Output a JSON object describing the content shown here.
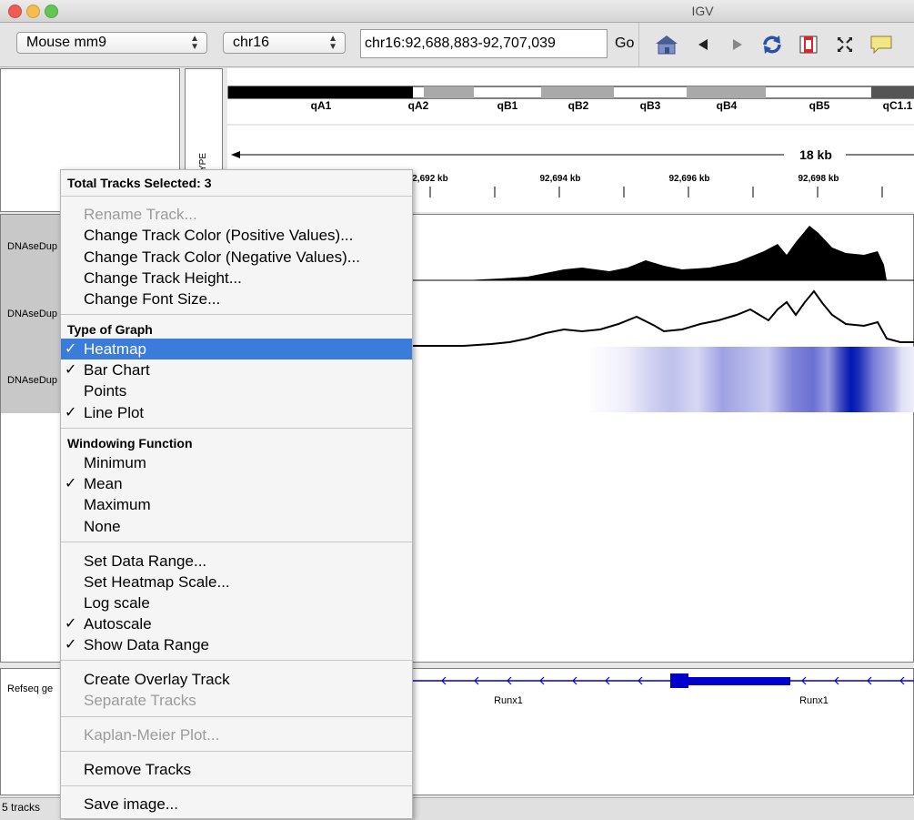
{
  "window": {
    "title": "IGV"
  },
  "toolbar": {
    "genome": "Mouse mm9",
    "chromosome": "chr16",
    "locus": "chr16:92,688,883-92,707,039",
    "go_label": "Go",
    "icons": [
      "home-icon",
      "back-icon",
      "forward-icon",
      "refresh-icon",
      "region-of-interest-icon",
      "resize-to-window-icon",
      "popup-text-icon"
    ]
  },
  "ruler": {
    "cytobands": [
      "qA1",
      "qA2",
      "qB1",
      "qB2",
      "qB3",
      "qB4",
      "qB5",
      "qC1.1"
    ],
    "span_label": "18 kb",
    "ticks": [
      "2,692 kb",
      "92,694 kb",
      "92,696 kb",
      "92,698 kb"
    ],
    "attribute_header": "YPE"
  },
  "tracks": {
    "data_track_names": [
      "DNAseDup",
      "DNAseDup",
      "DNAseDup"
    ],
    "gene_track_name": "Refseq ge",
    "gene_labels": [
      "Runx1",
      "Runx1"
    ]
  },
  "status": {
    "track_count": "5 tracks"
  },
  "colors": {
    "selection": "#3b7bdc",
    "heatmap": "#0018b0",
    "gene": "#0000cc"
  },
  "menu": {
    "header": "Total Tracks Selected: 3",
    "rename": "Rename Track...",
    "color_pos": "Change Track Color (Positive Values)...",
    "color_neg": "Change Track Color (Negative Values)...",
    "height": "Change Track Height...",
    "font": "Change Font Size...",
    "graph_header": "Type of Graph",
    "heatmap": "Heatmap",
    "bar_chart": "Bar Chart",
    "points": "Points",
    "line_plot": "Line Plot",
    "window_header": "Windowing Function",
    "minimum": "Minimum",
    "mean": "Mean",
    "maximum": "Maximum",
    "none": "None",
    "data_range": "Set Data Range...",
    "heatmap_scale": "Set Heatmap Scale...",
    "log_scale": "Log scale",
    "autoscale": "Autoscale",
    "show_range": "Show Data Range",
    "overlay": "Create Overlay Track",
    "separate": "Separate Tracks",
    "kaplan": "Kaplan-Meier Plot...",
    "remove": "Remove Tracks",
    "save": "Save image...",
    "check": "✓"
  }
}
